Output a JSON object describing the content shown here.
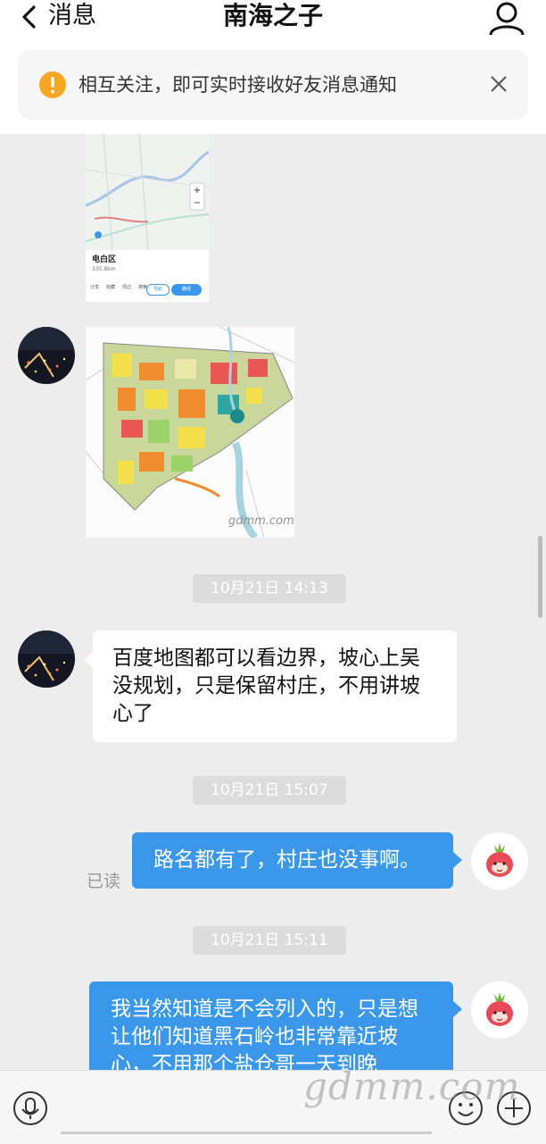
{
  "header": {
    "back_label": "消息",
    "title": "南海之子"
  },
  "notice": {
    "text": "相互关注，即可实时接收好友消息通知"
  },
  "map_card": {
    "place": "电白区",
    "distance": "335.8km",
    "actions": [
      "分享",
      "收藏",
      "周边",
      "搜索"
    ],
    "nav_button": "导航",
    "route_button": "路线"
  },
  "plan_image": {
    "watermark": "gdmm.com"
  },
  "messages": [
    {
      "type": "time",
      "text": "10月21日 14:13"
    },
    {
      "type": "incoming",
      "text": "百度地图都可以看边界，坡心上吴没规划，只是保留村庄，不用讲坡心了"
    },
    {
      "type": "time",
      "text": "10月21日 15:07"
    },
    {
      "type": "outgoing",
      "text": "路名都有了，村庄也没事啊。",
      "status": "已读"
    },
    {
      "type": "time",
      "text": "10月21日 15:11"
    },
    {
      "type": "outgoing",
      "text": "我当然知道是不会列入的，只是想让他们知道黑石岭也非常靠近坡心，不用那个盐仓哥一天到晚"
    }
  ],
  "page_watermark": "gdmm.com",
  "colors": {
    "accent": "#3b97e9",
    "background": "#ededed",
    "warning": "#f5a623"
  }
}
